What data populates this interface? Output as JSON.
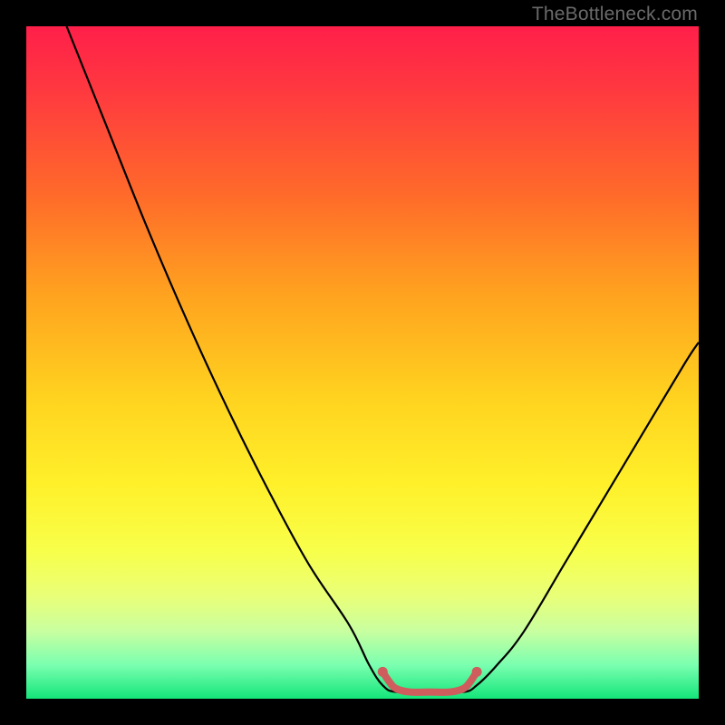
{
  "watermark": {
    "text": "TheBottleneck.com"
  },
  "chart_data": {
    "type": "line",
    "title": "",
    "xlabel": "",
    "ylabel": "",
    "xlim": [
      0,
      100
    ],
    "ylim": [
      0,
      100
    ],
    "background_gradient": {
      "stops": [
        {
          "pos": 0,
          "color": "#ff1f4a"
        },
        {
          "pos": 10,
          "color": "#ff3a3f"
        },
        {
          "pos": 25,
          "color": "#ff6a2a"
        },
        {
          "pos": 40,
          "color": "#ffa31f"
        },
        {
          "pos": 55,
          "color": "#ffd21f"
        },
        {
          "pos": 68,
          "color": "#fff02a"
        },
        {
          "pos": 78,
          "color": "#f8ff4a"
        },
        {
          "pos": 85,
          "color": "#e8ff7a"
        },
        {
          "pos": 90,
          "color": "#c8ffa0"
        },
        {
          "pos": 95,
          "color": "#7affb0"
        },
        {
          "pos": 100,
          "color": "#14e57a"
        }
      ]
    },
    "series": [
      {
        "name": "bottleneck-curve",
        "color": "#000000",
        "points": [
          {
            "x": 6,
            "y": 100
          },
          {
            "x": 12,
            "y": 85
          },
          {
            "x": 18,
            "y": 70
          },
          {
            "x": 24,
            "y": 56
          },
          {
            "x": 30,
            "y": 43
          },
          {
            "x": 36,
            "y": 31
          },
          {
            "x": 42,
            "y": 20
          },
          {
            "x": 48,
            "y": 11
          },
          {
            "x": 51,
            "y": 5
          },
          {
            "x": 53,
            "y": 2
          },
          {
            "x": 55,
            "y": 1
          },
          {
            "x": 60,
            "y": 1
          },
          {
            "x": 65,
            "y": 1
          },
          {
            "x": 67,
            "y": 2
          },
          {
            "x": 70,
            "y": 5
          },
          {
            "x": 74,
            "y": 10
          },
          {
            "x": 80,
            "y": 20
          },
          {
            "x": 86,
            "y": 30
          },
          {
            "x": 92,
            "y": 40
          },
          {
            "x": 98,
            "y": 50
          },
          {
            "x": 100,
            "y": 53
          }
        ]
      },
      {
        "name": "optimal-highlight",
        "color": "#cf5d5d",
        "points": [
          {
            "x": 53,
            "y": 4
          },
          {
            "x": 54,
            "y": 2.5
          },
          {
            "x": 55,
            "y": 1.5
          },
          {
            "x": 57,
            "y": 1
          },
          {
            "x": 60,
            "y": 1
          },
          {
            "x": 63,
            "y": 1
          },
          {
            "x": 65,
            "y": 1.5
          },
          {
            "x": 66,
            "y": 2.5
          },
          {
            "x": 67,
            "y": 4
          }
        ]
      }
    ]
  }
}
